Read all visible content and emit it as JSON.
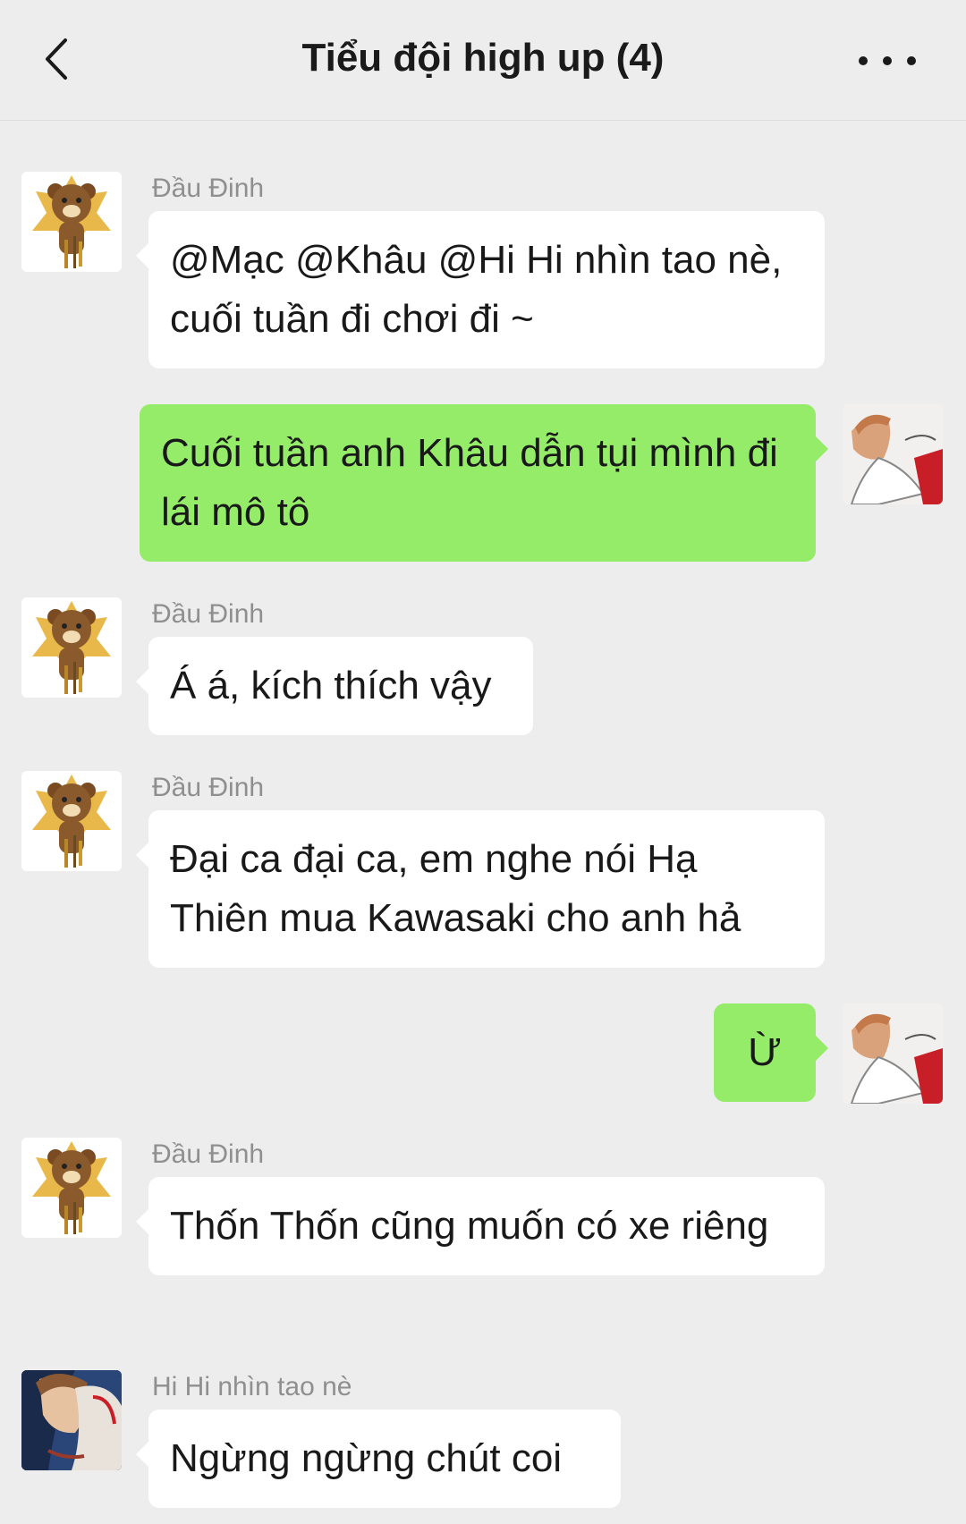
{
  "header": {
    "title": "Tiểu đội high up (4)",
    "back_icon": "chevron-left-icon",
    "more_icon": "more-dots-icon"
  },
  "messages": [
    {
      "side": "in",
      "sender": "Đầu Đinh",
      "avatar": "bear-avatar",
      "text": "@Mạc @Khâu @Hi Hi nhìn tao nè, cuối tuần đi chơi đi ~"
    },
    {
      "side": "out",
      "avatar": "self-avatar",
      "text": "Cuối tuần anh Khâu dẫn tụi mình đi lái mô tô"
    },
    {
      "side": "in",
      "sender": "Đầu Đinh",
      "avatar": "bear-avatar",
      "text": "Á á, kích thích vậy"
    },
    {
      "side": "in",
      "sender": "Đầu Đinh",
      "avatar": "bear-avatar",
      "text": "Đại ca đại ca, em nghe nói Hạ Thiên mua Kawasaki cho anh hả"
    },
    {
      "side": "out",
      "avatar": "self-avatar",
      "text": "Ừ"
    },
    {
      "side": "in",
      "sender": "Đầu Đinh",
      "avatar": "bear-avatar",
      "text": "Thốn Thốn cũng muốn có xe riêng"
    },
    {
      "side": "in",
      "sender": "Hi Hi nhìn tao nè",
      "avatar": "hihi-avatar",
      "text": "Ngừng ngừng chút coi"
    }
  ],
  "colors": {
    "background": "#ededed",
    "incoming_bubble": "#ffffff",
    "outgoing_bubble": "#95ec69",
    "sender_name": "#8f8f8f"
  }
}
